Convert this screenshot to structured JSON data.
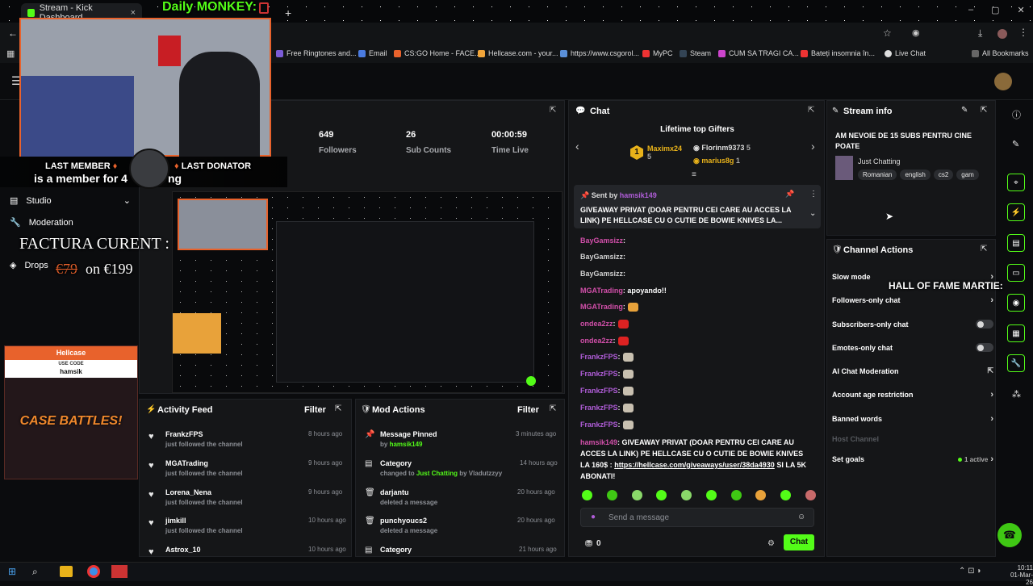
{
  "tabs": [
    {
      "label": "Stream - Kick Dashboard",
      "active": true
    }
  ],
  "overlay": {
    "title": "Daily MONKEY:",
    "last_member_label": "LAST MEMBER",
    "last_member_text": "is a member for 4",
    "last_member_suffix": "ng",
    "last_donator_label": "LAST DONATOR",
    "factura": "FACTURA CURENT :",
    "price_old": "€79",
    "price_new": "on €199",
    "hall_of_fame": "HALL OF FAME MARTIE:",
    "hellcase_brand": "Hellcase",
    "use_code": "USE CODE",
    "code": "hamsik",
    "case_battles": "CASE BATTLES!"
  },
  "bookmarks": [
    "Free Ringtones and...",
    "Email",
    "CS:GO Home - FACE...",
    "Hellcase.com - your...",
    "https://www.csgorol...",
    "MyPC",
    "Steam",
    "CUM SA TRAGI CA...",
    "Bateți insomnia în...",
    "Live Chat",
    "All Bookmarks"
  ],
  "sidebar": {
    "items": [
      {
        "label": "Studio"
      },
      {
        "label": "Moderation"
      },
      {
        "label": "Drops"
      }
    ]
  },
  "stats": [
    {
      "value": "649",
      "label": "Followers"
    },
    {
      "value": "26",
      "label": "Sub Counts"
    },
    {
      "value": "00:00:59",
      "label": "Time Live"
    }
  ],
  "chat": {
    "title": "Chat",
    "gifters_title": "Lifetime top Gifters",
    "gifters": [
      {
        "name": "Maximx24",
        "count": "5",
        "rank": "1"
      },
      {
        "name": "Florinm9373",
        "count": "5"
      },
      {
        "name": "marius8g",
        "count": "1"
      }
    ],
    "pinned_by_label": "Sent by",
    "pinned_by": "hamsik149",
    "pinned_text": "GIVEAWAY PRIVAT (DOAR PENTRU CEI CARE AU ACCES LA LINK) PE HELLCASE CU O CUTIE DE BOWIE KNIVES LA...",
    "messages": [
      {
        "user": "BayGamsizz",
        "text": ""
      },
      {
        "user": "BayGamsizz",
        "text": ""
      },
      {
        "user": "BayGamsizz",
        "text": ""
      },
      {
        "user": "MGATrading",
        "text": "apoyando!!"
      },
      {
        "user": "MGATrading",
        "text": ""
      },
      {
        "user": "ondea2zz",
        "text": ""
      },
      {
        "user": "ondea2zz",
        "text": ""
      },
      {
        "user": "FrankzFPS",
        "text": ""
      },
      {
        "user": "FrankzFPS",
        "text": ""
      },
      {
        "user": "FrankzFPS",
        "text": ""
      },
      {
        "user": "FrankzFPS",
        "text": ""
      },
      {
        "user": "FrankzFPS",
        "text": ""
      }
    ],
    "last_msg_user": "hamsik149",
    "last_msg_text": "GIVEAWAY PRIVAT (DOAR PENTRU CEI CARE AU ACCES LA LINK) PE HELLCASE CU O CUTIE DE BOWIE KNIVES LA 160$ :",
    "last_msg_link": "https://hellcase.com/giveaways/user/38da4930",
    "last_msg_tail": "SI LA 5K ABONATI!",
    "input_placeholder": "Send a message",
    "points": "0",
    "send_label": "Chat"
  },
  "stream_info": {
    "title": "Stream info",
    "stream_title": "AM NEVOIE DE 15 SUBS PENTRU CINE POATE",
    "category": "Just Chatting",
    "tags": [
      "Romanian",
      "english",
      "cs2",
      "gam"
    ]
  },
  "channel_actions": {
    "title": "Channel Actions",
    "rows": [
      {
        "label": "Slow mode",
        "control": "chevron"
      },
      {
        "label": "Followers-only chat",
        "control": "chevron"
      },
      {
        "label": "Subscribers-only chat",
        "control": "toggle"
      },
      {
        "label": "Emotes-only chat",
        "control": "toggle"
      },
      {
        "label": "AI Chat Moderation",
        "control": "external"
      },
      {
        "label": "Account age restriction",
        "control": "chevron"
      },
      {
        "label": "Banned words",
        "control": "chevron"
      },
      {
        "label": "Host Channel",
        "control": "none",
        "disabled": true
      },
      {
        "label": "Set goals",
        "control": "chevron",
        "status": "1 active"
      }
    ]
  },
  "activity": {
    "title": "Activity Feed",
    "filter": "Filter",
    "items": [
      {
        "name": "FrankzFPS",
        "sub": "just followed the channel",
        "time": "8 hours ago"
      },
      {
        "name": "MGATrading",
        "sub": "just followed the channel",
        "time": "9 hours ago"
      },
      {
        "name": "Lorena_Nena",
        "sub": "just followed the channel",
        "time": "9 hours ago"
      },
      {
        "name": "jimkill",
        "sub": "just followed the channel",
        "time": "10 hours ago"
      },
      {
        "name": "Astrox_10",
        "sub": "",
        "time": "10 hours ago"
      }
    ]
  },
  "mod": {
    "title": "Mod Actions",
    "filter": "Filter",
    "items": [
      {
        "name": "Message Pinned",
        "sub_prefix": "by",
        "sub_user": "hamsik149",
        "sub_rest": "",
        "time": "3 minutes ago",
        "icon": "pin-icon"
      },
      {
        "name": "Category",
        "sub_prefix": "changed to",
        "sub_user": "Just Chatting",
        "sub_rest": "by Vladutzzyy",
        "time": "14 hours ago",
        "icon": "category-icon"
      },
      {
        "name": "darjantu",
        "sub_prefix": "deleted a message",
        "sub_user": "",
        "sub_rest": "",
        "time": "20 hours ago",
        "icon": "trash-icon"
      },
      {
        "name": "punchyoucs2",
        "sub_prefix": "deleted a message",
        "sub_user": "",
        "sub_rest": "",
        "time": "20 hours ago",
        "icon": "trash-icon"
      },
      {
        "name": "Category",
        "sub_prefix": "",
        "sub_user": "",
        "sub_rest": "",
        "time": "21 hours ago",
        "icon": "category-icon"
      }
    ]
  },
  "taskbar": {
    "time": "10:11",
    "date": "01-Mar-26"
  },
  "colors": {
    "accent": "#53fc18",
    "bg": "#0b0c0e",
    "panel": "#151618"
  }
}
